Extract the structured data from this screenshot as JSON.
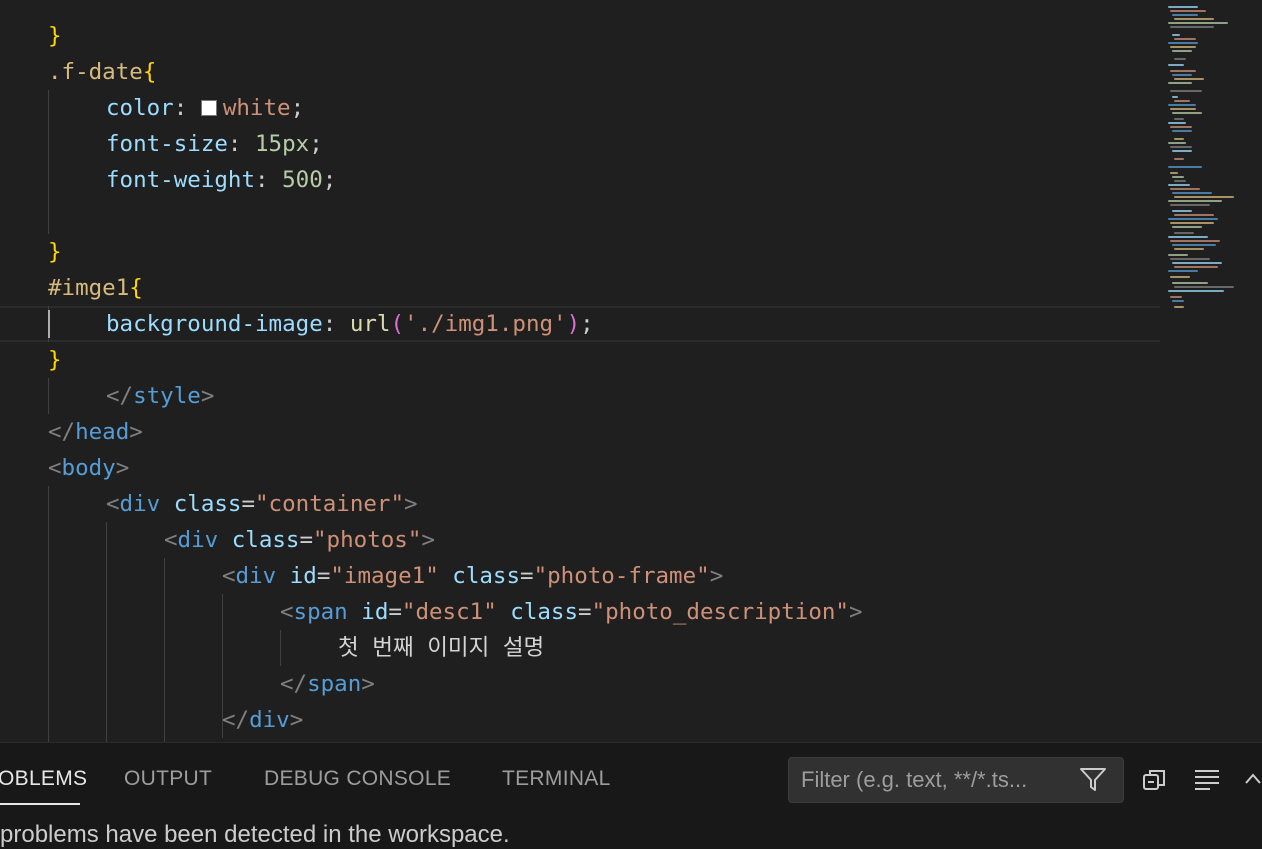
{
  "editor": {
    "lines": [
      {
        "indent": 0,
        "tokens": [
          {
            "c": "t-brace",
            "t": "}"
          }
        ]
      },
      {
        "indent": 0,
        "tokens": [
          {
            "c": "t-sel",
            "t": ".f-date"
          },
          {
            "c": "t-brace",
            "t": "{"
          }
        ]
      },
      {
        "indent": 1,
        "tokens": [
          {
            "c": "t-prop",
            "t": "color"
          },
          {
            "c": "t-punc",
            "t": ": "
          },
          {
            "c": "swatch",
            "t": ""
          },
          {
            "c": "t-val",
            "t": "white"
          },
          {
            "c": "t-punc",
            "t": ";"
          }
        ]
      },
      {
        "indent": 1,
        "tokens": [
          {
            "c": "t-prop",
            "t": "font-size"
          },
          {
            "c": "t-punc",
            "t": ": "
          },
          {
            "c": "t-num",
            "t": "15px"
          },
          {
            "c": "t-punc",
            "t": ";"
          }
        ]
      },
      {
        "indent": 1,
        "tokens": [
          {
            "c": "t-prop",
            "t": "font-weight"
          },
          {
            "c": "t-punc",
            "t": ": "
          },
          {
            "c": "t-num",
            "t": "500"
          },
          {
            "c": "t-punc",
            "t": ";"
          }
        ]
      },
      {
        "indent": 0,
        "tokens": []
      },
      {
        "indent": 0,
        "tokens": [
          {
            "c": "t-brace",
            "t": "}"
          }
        ]
      },
      {
        "indent": 0,
        "tokens": [
          {
            "c": "t-sel",
            "t": "#imge1"
          },
          {
            "c": "t-brace",
            "t": "{"
          }
        ]
      },
      {
        "indent": 1,
        "current": true,
        "tokens": [
          {
            "c": "t-prop",
            "t": "background-image"
          },
          {
            "c": "t-punc",
            "t": ": "
          },
          {
            "c": "t-fn",
            "t": "url"
          },
          {
            "c": "t-paren",
            "t": "("
          },
          {
            "c": "t-str",
            "t": "'./img1.png'"
          },
          {
            "c": "t-paren",
            "t": ")"
          },
          {
            "c": "t-punc",
            "t": ";"
          }
        ]
      },
      {
        "indent": 0,
        "tokens": [
          {
            "c": "t-brace",
            "t": "}"
          }
        ]
      },
      {
        "indent": 1,
        "tokens": [
          {
            "c": "t-bracket",
            "t": "</"
          },
          {
            "c": "t-tag",
            "t": "style"
          },
          {
            "c": "t-bracket",
            "t": ">"
          }
        ]
      },
      {
        "indent": 0,
        "tokens": [
          {
            "c": "t-bracket",
            "t": "</"
          },
          {
            "c": "t-tag",
            "t": "head"
          },
          {
            "c": "t-bracket",
            "t": ">"
          }
        ]
      },
      {
        "indent": 0,
        "tokens": [
          {
            "c": "t-bracket",
            "t": "<"
          },
          {
            "c": "t-tag",
            "t": "body"
          },
          {
            "c": "t-bracket",
            "t": ">"
          }
        ]
      },
      {
        "indent": 1,
        "tokens": [
          {
            "c": "t-bracket",
            "t": "<"
          },
          {
            "c": "t-tag",
            "t": "div"
          },
          {
            "c": "t-punc",
            "t": " "
          },
          {
            "c": "t-attr",
            "t": "class"
          },
          {
            "c": "t-punc",
            "t": "="
          },
          {
            "c": "t-str",
            "t": "\"container\""
          },
          {
            "c": "t-bracket",
            "t": ">"
          }
        ]
      },
      {
        "indent": 2,
        "tokens": [
          {
            "c": "t-bracket",
            "t": "<"
          },
          {
            "c": "t-tag",
            "t": "div"
          },
          {
            "c": "t-punc",
            "t": " "
          },
          {
            "c": "t-attr",
            "t": "class"
          },
          {
            "c": "t-punc",
            "t": "="
          },
          {
            "c": "t-str",
            "t": "\"photos\""
          },
          {
            "c": "t-bracket",
            "t": ">"
          }
        ]
      },
      {
        "indent": 3,
        "tokens": [
          {
            "c": "t-bracket",
            "t": "<"
          },
          {
            "c": "t-tag",
            "t": "div"
          },
          {
            "c": "t-punc",
            "t": " "
          },
          {
            "c": "t-attr",
            "t": "id"
          },
          {
            "c": "t-punc",
            "t": "="
          },
          {
            "c": "t-str",
            "t": "\"image1\""
          },
          {
            "c": "t-punc",
            "t": " "
          },
          {
            "c": "t-attr",
            "t": "class"
          },
          {
            "c": "t-punc",
            "t": "="
          },
          {
            "c": "t-str",
            "t": "\"photo-frame\""
          },
          {
            "c": "t-bracket",
            "t": ">"
          }
        ]
      },
      {
        "indent": 4,
        "tokens": [
          {
            "c": "t-bracket",
            "t": "<"
          },
          {
            "c": "t-tag",
            "t": "span"
          },
          {
            "c": "t-punc",
            "t": " "
          },
          {
            "c": "t-attr",
            "t": "id"
          },
          {
            "c": "t-punc",
            "t": "="
          },
          {
            "c": "t-str",
            "t": "\"desc1\""
          },
          {
            "c": "t-punc",
            "t": " "
          },
          {
            "c": "t-attr",
            "t": "class"
          },
          {
            "c": "t-punc",
            "t": "="
          },
          {
            "c": "t-str",
            "t": "\"photo_description\""
          },
          {
            "c": "t-bracket",
            "t": ">"
          }
        ]
      },
      {
        "indent": 5,
        "tokens": [
          {
            "c": "t-text",
            "t": "첫 번째 이미지 설명"
          }
        ]
      },
      {
        "indent": 4,
        "tokens": [
          {
            "c": "t-bracket",
            "t": "</"
          },
          {
            "c": "t-tag",
            "t": "span"
          },
          {
            "c": "t-bracket",
            "t": ">"
          }
        ]
      },
      {
        "indent": 3,
        "tokens": [
          {
            "c": "t-bracket",
            "t": "</"
          },
          {
            "c": "t-tag",
            "t": "div"
          },
          {
            "c": "t-bracket",
            "t": ">"
          }
        ]
      },
      {
        "indent": 3,
        "tokens": []
      }
    ]
  },
  "panel": {
    "tabs": [
      {
        "label": "OBLEMS",
        "active": true
      },
      {
        "label": "OUTPUT",
        "active": false
      },
      {
        "label": "DEBUG CONSOLE",
        "active": false
      },
      {
        "label": "TERMINAL",
        "active": false
      }
    ],
    "filter_placeholder": "Filter (e.g. text, **/*.ts...",
    "status": "problems have been detected in the workspace.",
    "icons": [
      "filter-icon",
      "collapse-all-icon",
      "word-wrap-icon",
      "chevron-up-icon"
    ]
  },
  "colors": {
    "editor_bg": "#1f1f1f",
    "panel_bg": "#181818",
    "keyword": "#569cd6",
    "string": "#ce9178",
    "property": "#9cdcfe",
    "brace": "#ffd700"
  }
}
